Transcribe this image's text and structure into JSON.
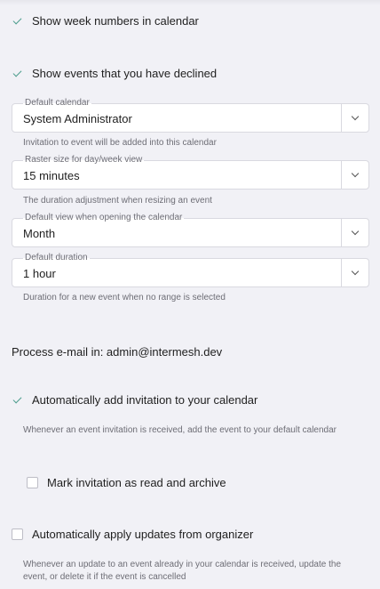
{
  "settings": {
    "week_numbers": {
      "label": "Show week numbers in calendar",
      "checked": true
    },
    "declined_events": {
      "label": "Show events that you have declined",
      "checked": true
    },
    "default_calendar": {
      "legend": "Default calendar",
      "value": "System Administrator",
      "hint": "Invitation to event will be added into this calendar"
    },
    "raster_size": {
      "legend": "Raster size for day/week view",
      "value": "15 minutes",
      "hint": "The duration adjustment when resizing an event"
    },
    "default_view": {
      "legend": "Default view when opening the calendar",
      "value": "Month"
    },
    "default_duration": {
      "legend": "Default duration",
      "value": "1 hour",
      "hint": "Duration for a new event when no range is selected"
    },
    "process_email": {
      "title": "Process e-mail in: admin@intermesh.dev"
    },
    "auto_add_invitation": {
      "label": "Automatically add invitation to your calendar",
      "checked": true,
      "hint": "Whenever an event invitation is received, add the event to your default calendar"
    },
    "mark_read_archive": {
      "label": "Mark invitation as read and archive",
      "checked": false
    },
    "auto_apply_updates": {
      "label": "Automatically apply updates from organizer",
      "checked": false,
      "hint": "Whenever an update to an event already in your calendar is received, update the event, or delete it if the event is cancelled"
    }
  },
  "colors": {
    "accent": "#4a9c8c",
    "background": "#f1f1f6",
    "field_border": "#d9d9e0"
  }
}
